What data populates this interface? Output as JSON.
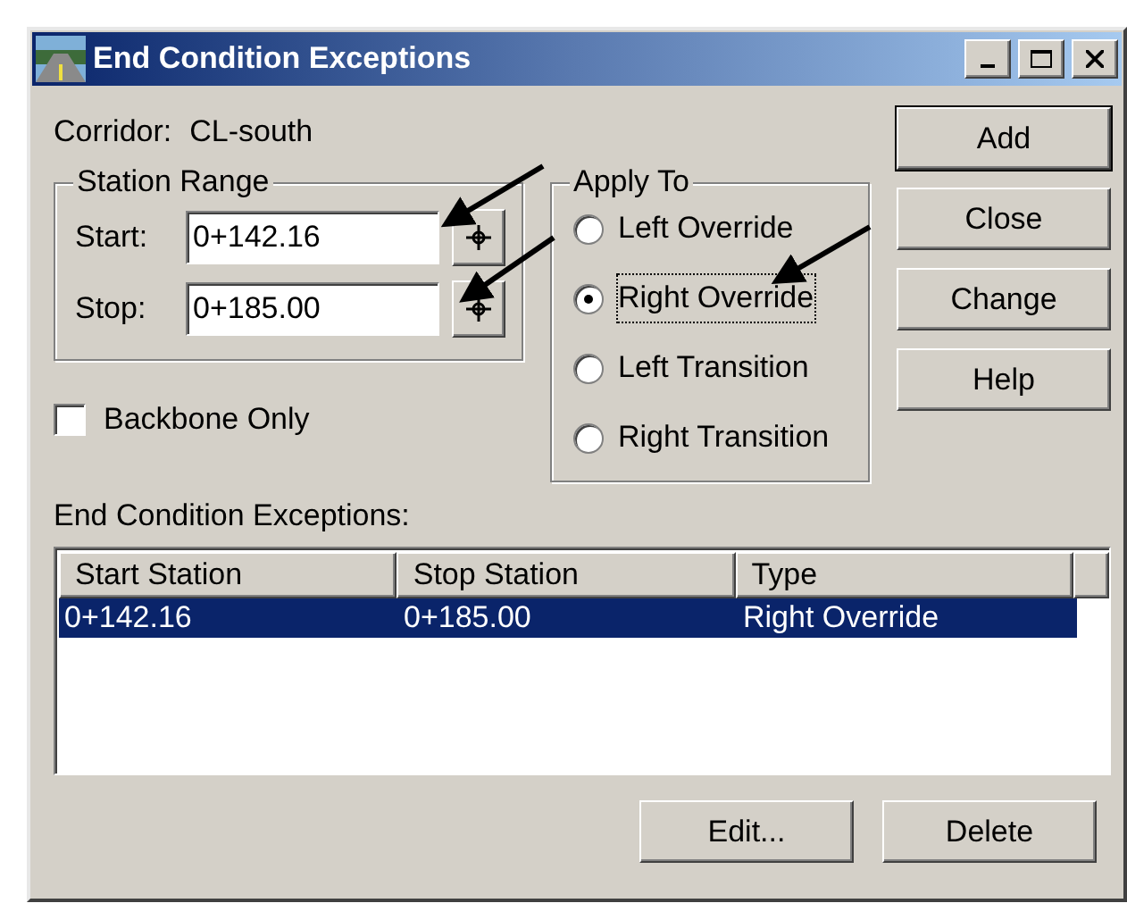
{
  "window": {
    "title": "End Condition Exceptions"
  },
  "corridor": {
    "label": "Corridor:",
    "value": "CL-south"
  },
  "station_range": {
    "title": "Station Range",
    "fields": [
      {
        "label": "Start:",
        "value": "0+142.16"
      },
      {
        "label": "Stop:",
        "value": "0+185.00"
      }
    ]
  },
  "backbone_only": {
    "label": "Backbone Only",
    "checked": false
  },
  "apply_to": {
    "title": "Apply To",
    "options": [
      {
        "label": "Left Override",
        "selected": false,
        "focused": false
      },
      {
        "label": "Right Override",
        "selected": true,
        "focused": true
      },
      {
        "label": "Left Transition",
        "selected": false,
        "focused": false
      },
      {
        "label": "Right Transition",
        "selected": false,
        "focused": false
      }
    ]
  },
  "side_buttons": [
    {
      "label": "Add",
      "default": true
    },
    {
      "label": "Close",
      "default": false
    },
    {
      "label": "Change",
      "default": false
    },
    {
      "label": "Help",
      "default": false
    }
  ],
  "exceptions": {
    "label": "End Condition Exceptions:",
    "columns": [
      "Start Station",
      "Stop Station",
      "Type"
    ],
    "rows": [
      {
        "cells": [
          "0+142.16",
          "0+185.00",
          "Right Override"
        ],
        "selected": true
      }
    ]
  },
  "bottom_buttons": [
    "Edit...",
    "Delete"
  ]
}
